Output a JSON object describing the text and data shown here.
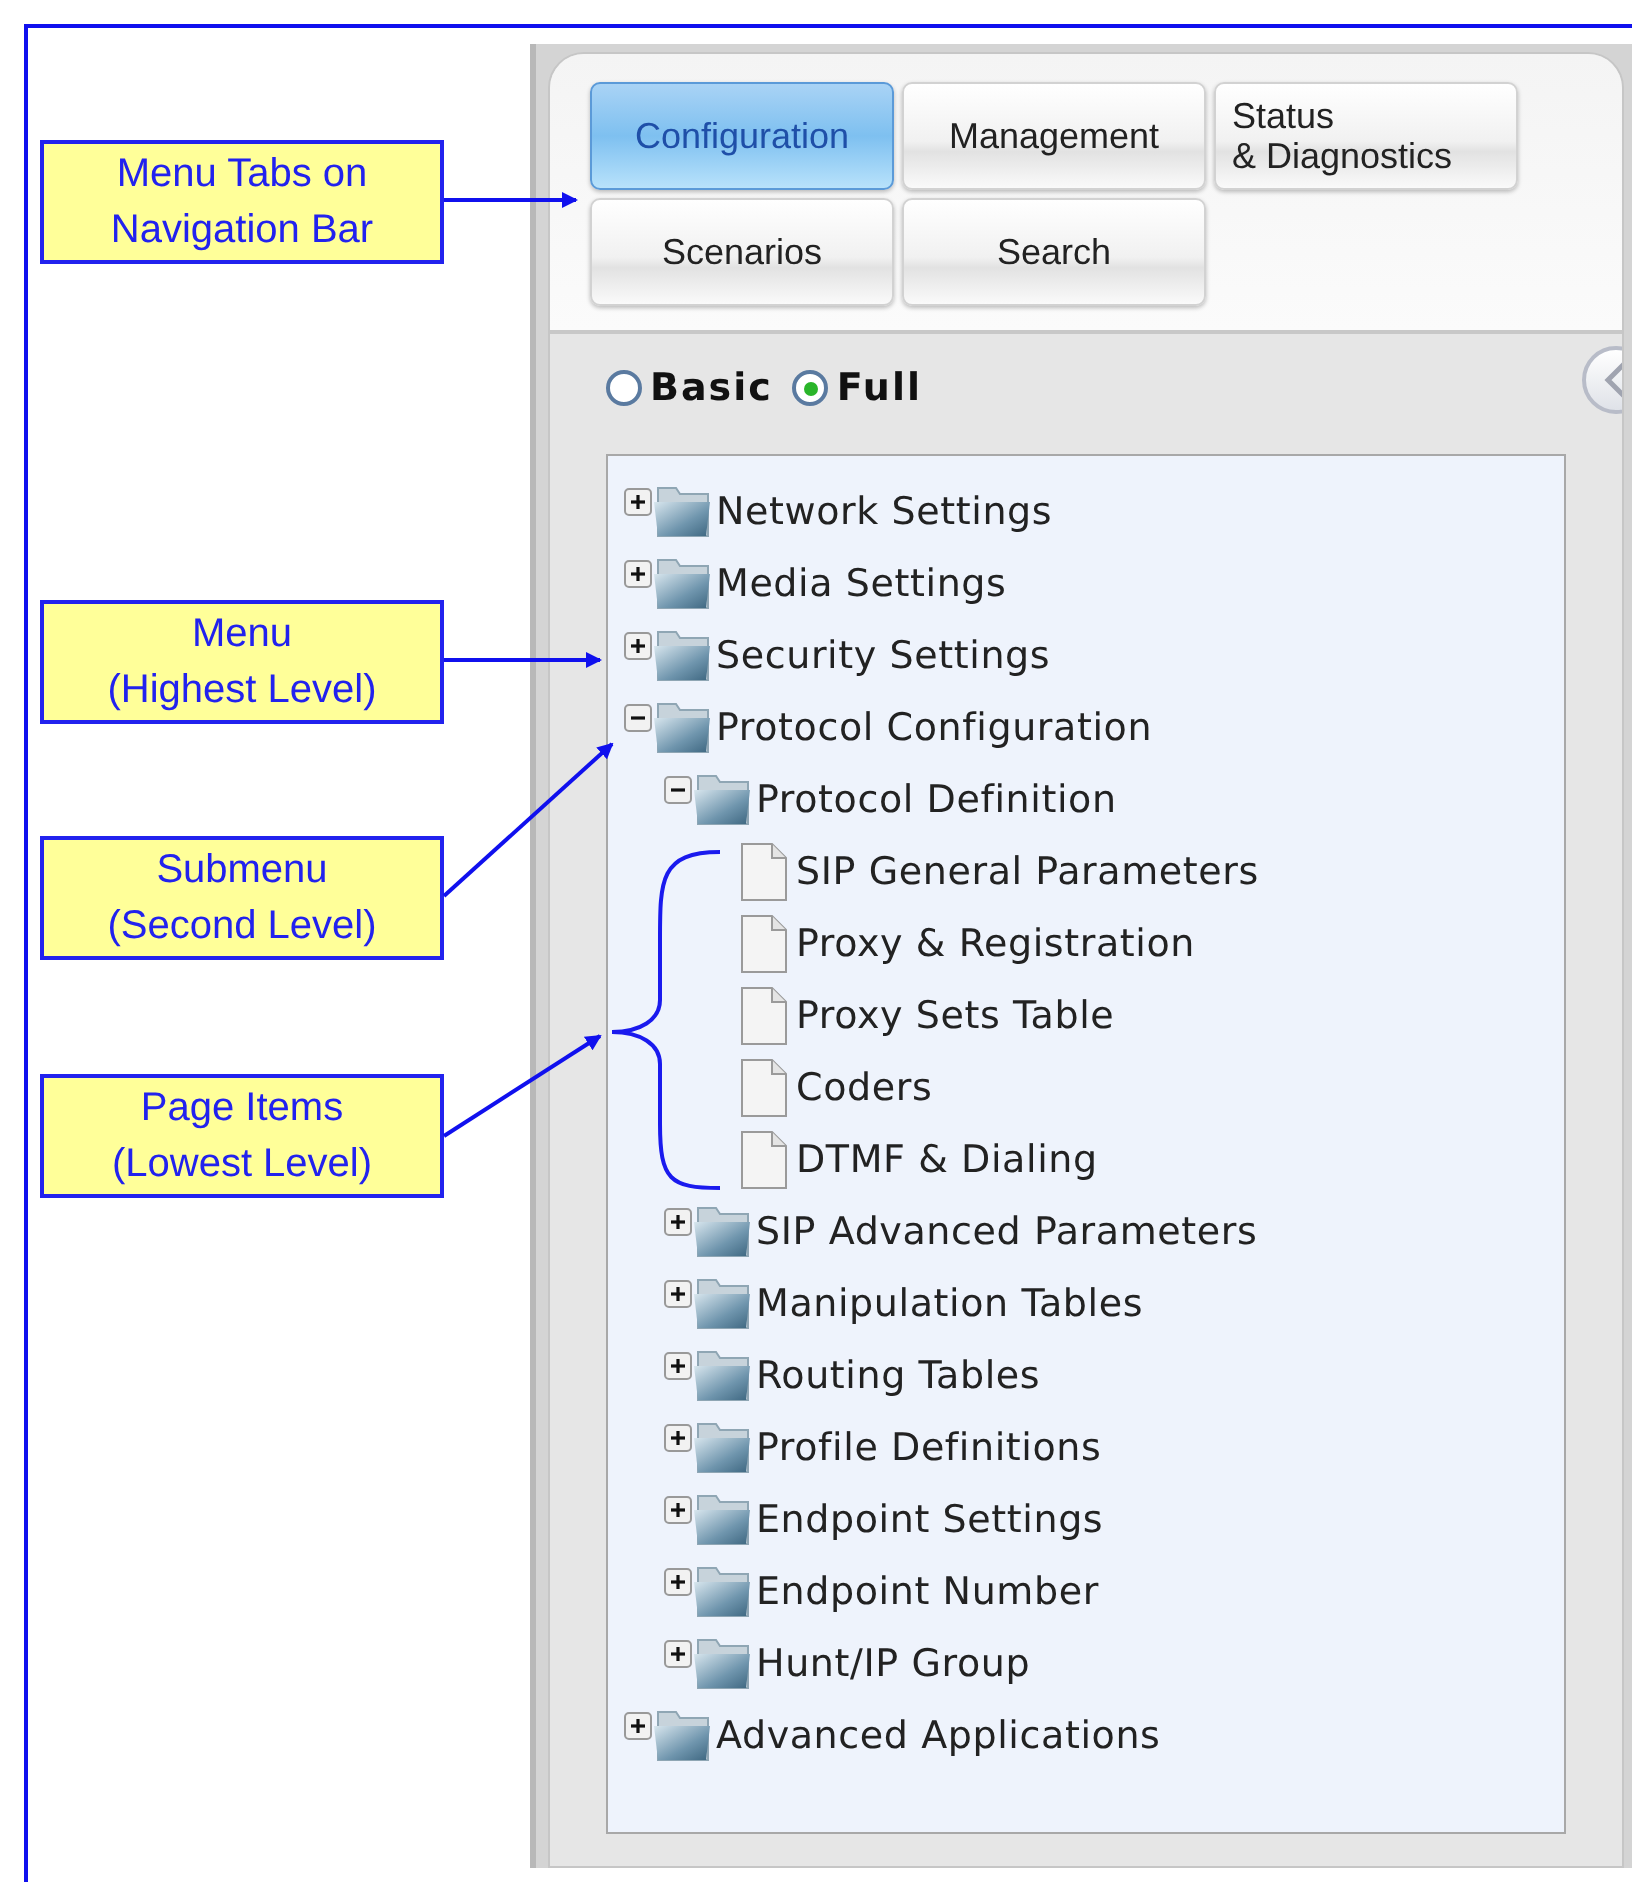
{
  "callouts": [
    {
      "text": "Menu Tabs on\nNavigation Bar"
    },
    {
      "text": "Menu\n(Highest Level)"
    },
    {
      "text": "Submenu\n(Second Level)"
    },
    {
      "text": "Page Items\n(Lowest Level)"
    }
  ],
  "tabs": [
    {
      "label": "Configuration",
      "selected": true
    },
    {
      "label": "Management",
      "selected": false
    },
    {
      "label": "Status\n& Diagnostics",
      "selected": false
    },
    {
      "label": "Scenarios",
      "selected": false
    },
    {
      "label": "Search",
      "selected": false
    }
  ],
  "view_modes": [
    {
      "label": "Basic",
      "selected": false
    },
    {
      "label": "Full",
      "selected": true
    }
  ],
  "tree": [
    {
      "kind": "folder",
      "label": "Network Settings",
      "expanded": false
    },
    {
      "kind": "folder",
      "label": "Media Settings",
      "expanded": false
    },
    {
      "kind": "folder",
      "label": "Security Settings",
      "expanded": false
    },
    {
      "kind": "folder",
      "label": "Protocol Configuration",
      "expanded": true,
      "children": [
        {
          "kind": "folder",
          "label": "Protocol Definition",
          "expanded": true,
          "children": [
            {
              "kind": "page",
              "label": "SIP General Parameters"
            },
            {
              "kind": "page",
              "label": "Proxy & Registration"
            },
            {
              "kind": "page",
              "label": "Proxy Sets Table"
            },
            {
              "kind": "page",
              "label": "Coders"
            },
            {
              "kind": "page",
              "label": "DTMF & Dialing"
            }
          ]
        },
        {
          "kind": "folder",
          "label": "SIP Advanced Parameters",
          "expanded": false
        },
        {
          "kind": "folder",
          "label": "Manipulation Tables",
          "expanded": false
        },
        {
          "kind": "folder",
          "label": "Routing Tables",
          "expanded": false
        },
        {
          "kind": "folder",
          "label": "Profile Definitions",
          "expanded": false
        },
        {
          "kind": "folder",
          "label": "Endpoint Settings",
          "expanded": false
        },
        {
          "kind": "folder",
          "label": "Endpoint Number",
          "expanded": false
        },
        {
          "kind": "folder",
          "label": "Hunt/IP Group",
          "expanded": false
        }
      ]
    },
    {
      "kind": "folder",
      "label": "Advanced Applications",
      "expanded": false
    }
  ]
}
